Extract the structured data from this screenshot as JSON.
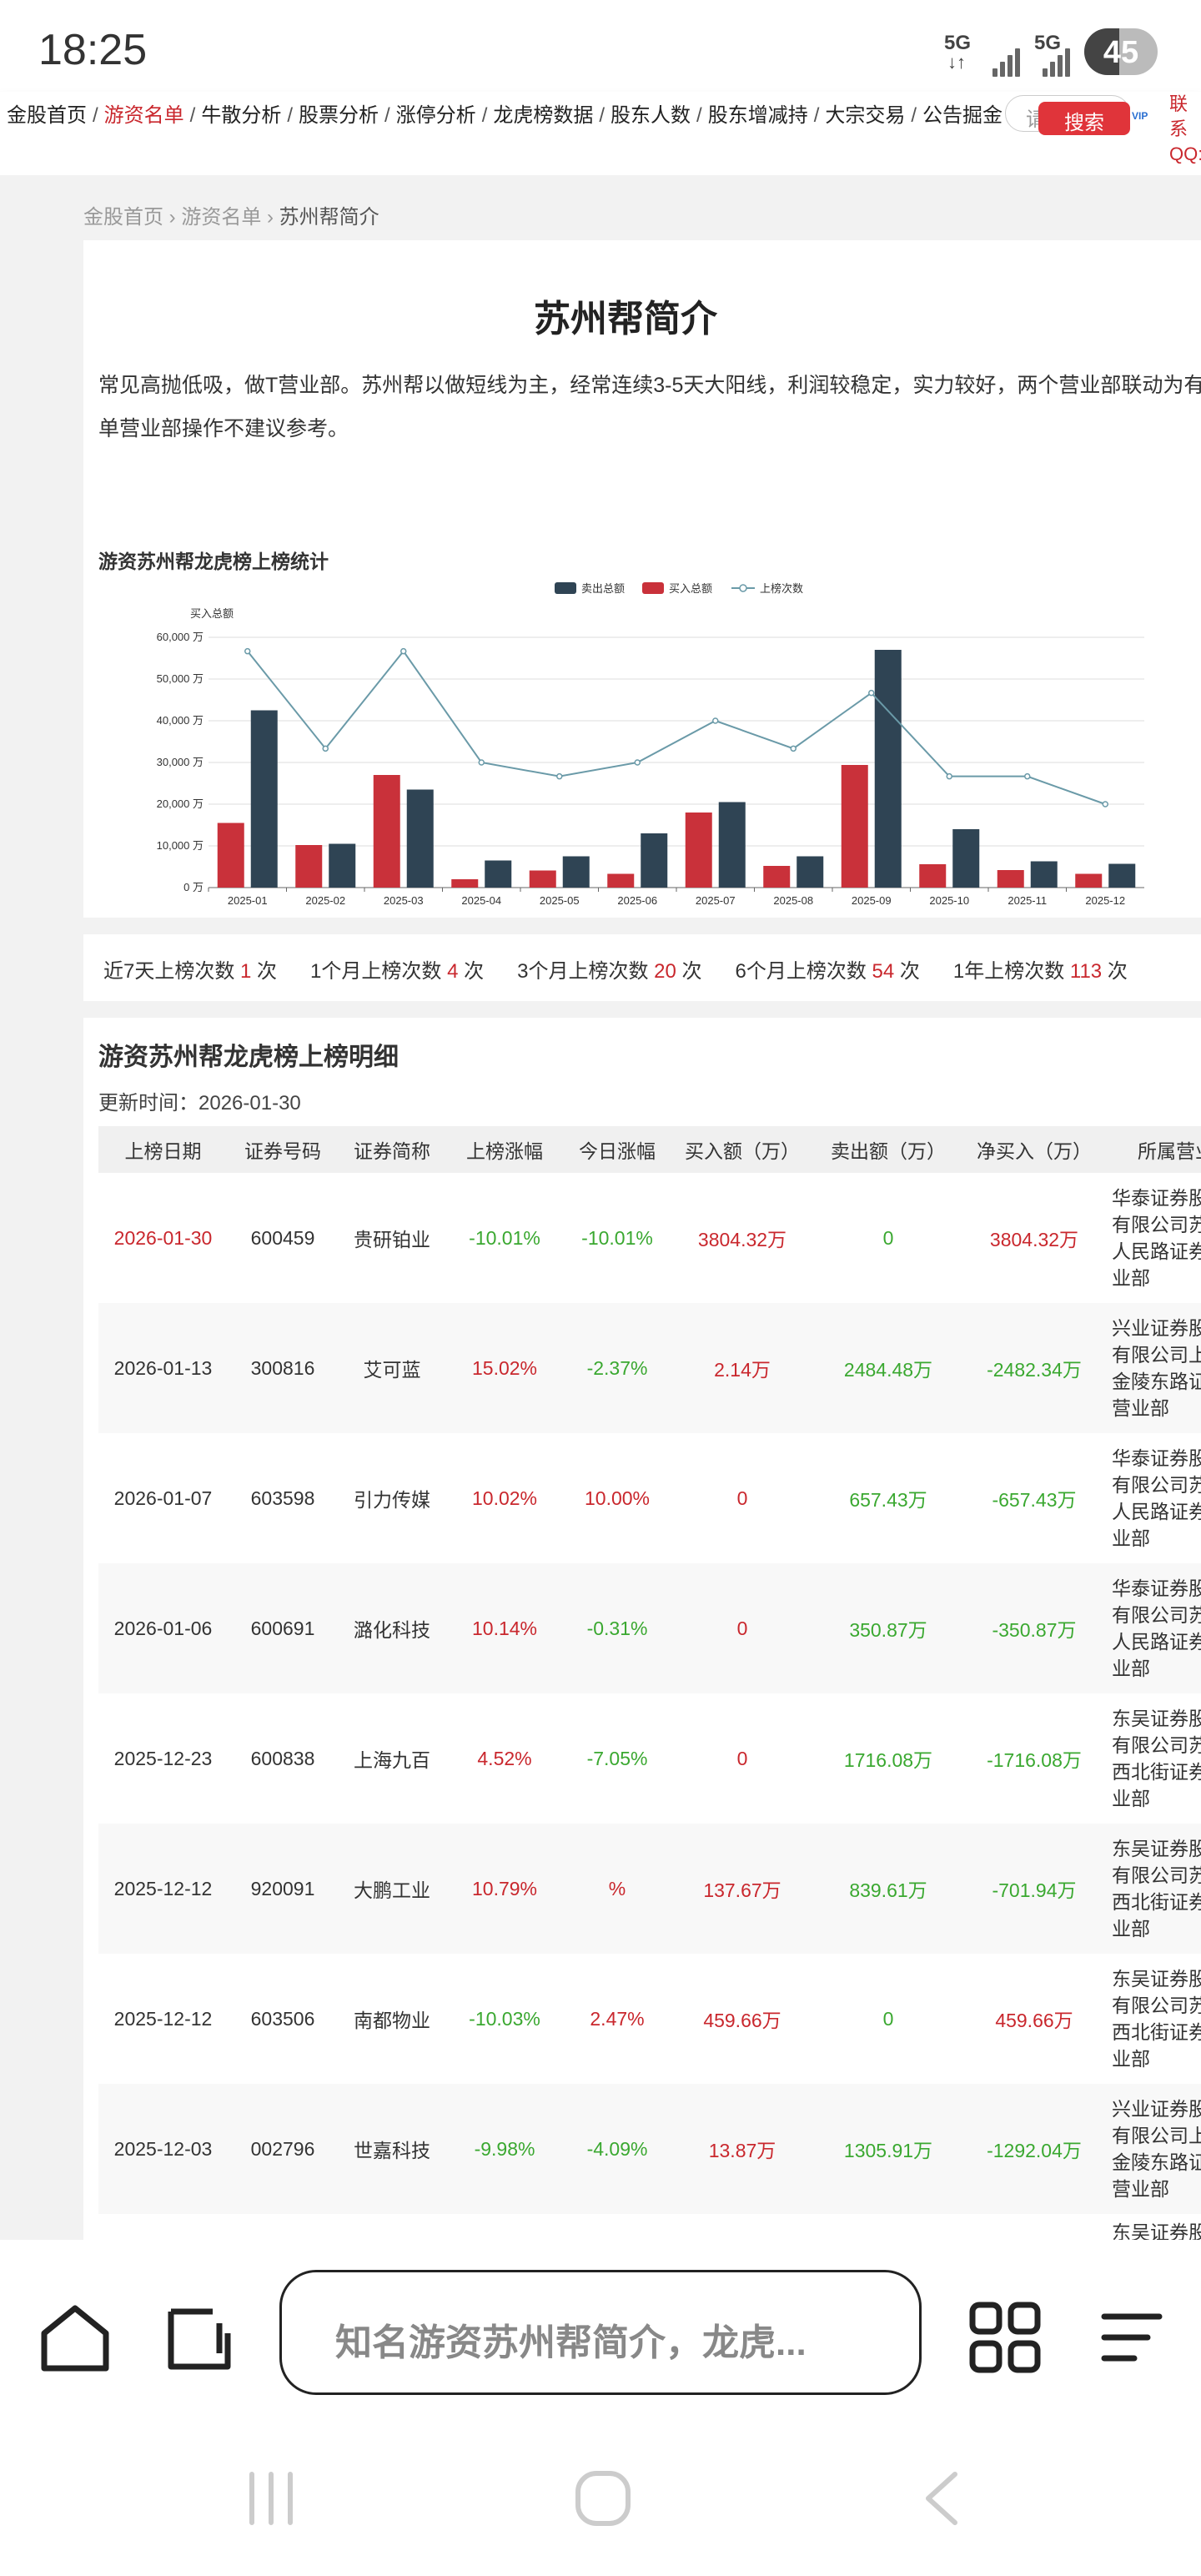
{
  "status": {
    "time": "18:25",
    "net1": "5G",
    "net2": "5G",
    "battery": "45"
  },
  "nav": {
    "items": [
      {
        "label": "金股首页",
        "active": false
      },
      {
        "label": "游资名单",
        "active": true
      },
      {
        "label": "牛散分析",
        "active": false
      },
      {
        "label": "股票分析",
        "active": false
      },
      {
        "label": "涨停分析",
        "active": false
      },
      {
        "label": "龙虎榜数据",
        "active": false
      },
      {
        "label": "股东人数",
        "active": false
      },
      {
        "label": "股东增减持",
        "active": false
      },
      {
        "label": "大宗交易",
        "active": false
      },
      {
        "label": "公告掘金",
        "active": false
      }
    ],
    "search_placeholder": "请",
    "search_button": "搜索",
    "vip": "VIP",
    "contact_line1": "联系",
    "contact_line2": "QQ:"
  },
  "breadcrumb": {
    "home": "金股首页",
    "list": "游资名单",
    "current": "苏州帮简介"
  },
  "intro": {
    "title": "苏州帮简介",
    "line1": "常见高抛低吸，做T营业部。苏州帮以做短线为主，经常连续3-5天大阳线，利润较稳定，实力较好，两个营业部联动为有",
    "line2": "单营业部操作不建议参考。"
  },
  "chart_data": {
    "type": "bar",
    "title": "游资苏州帮龙虎榜上榜统计",
    "ylabel": "买入总额",
    "ylim": [
      0,
      60000
    ],
    "yticks": [
      "0 万",
      "10,000 万",
      "20,000 万",
      "30,000 万",
      "40,000 万",
      "50,000 万",
      "60,000 万"
    ],
    "categories": [
      "2025-01",
      "2025-02",
      "2025-03",
      "2025-04",
      "2025-05",
      "2025-06",
      "2025-07",
      "2025-08",
      "2025-09",
      "2025-10",
      "2025-11",
      "2025-12"
    ],
    "series": [
      {
        "name": "卖出总额",
        "kind": "bar",
        "color": "#2f4454",
        "values": [
          42500,
          10500,
          23500,
          6500,
          7500,
          13000,
          20500,
          7500,
          57000,
          14000,
          6300,
          5700
        ]
      },
      {
        "name": "买入总额",
        "kind": "bar",
        "color": "#c9313a",
        "values": [
          15500,
          10200,
          27000,
          2000,
          4100,
          3300,
          18000,
          5200,
          29400,
          5600,
          4200,
          3300
        ]
      },
      {
        "name": "上榜次数",
        "kind": "line",
        "color": "#6a9aa8",
        "values": [
          17,
          10,
          17,
          9,
          8,
          9,
          12,
          10,
          14,
          8,
          8,
          6
        ]
      }
    ],
    "line_ymax": 18,
    "legend_position": "top-center",
    "grid": true
  },
  "stats": [
    {
      "label": "近7天上榜次数",
      "value": "1",
      "unit": "次"
    },
    {
      "label": "1个月上榜次数",
      "value": "4",
      "unit": "次"
    },
    {
      "label": "3个月上榜次数",
      "value": "20",
      "unit": "次"
    },
    {
      "label": "6个月上榜次数",
      "value": "54",
      "unit": "次"
    },
    {
      "label": "1年上榜次数",
      "value": "113",
      "unit": "次"
    }
  ],
  "detail": {
    "title": "游资苏州帮龙虎榜上榜明细",
    "update_label": "更新时间：",
    "update_value": "2026-01-30",
    "headers": [
      "上榜日期",
      "证券号码",
      "证券简称",
      "上榜涨幅",
      "今日涨幅",
      "买入额（万）",
      "卖出额（万）",
      "净买入（万）",
      "所属营业部"
    ],
    "rows": [
      {
        "date": "2026-01-30",
        "code": "600459",
        "name": "贵研铂业",
        "rise": "-10.01%",
        "today": "-10.01%",
        "buy": "3804.32万",
        "sell": "0",
        "net": "3804.32万",
        "dept": [
          "华泰证券股",
          "有限公司苏",
          "人民路证券",
          "业部"
        ],
        "date_red": true
      },
      {
        "date": "2026-01-13",
        "code": "300816",
        "name": "艾可蓝",
        "rise": "15.02%",
        "today": "-2.37%",
        "buy": "2.14万",
        "sell": "2484.48万",
        "net": "-2482.34万",
        "dept": [
          "兴业证券股",
          "有限公司上",
          "金陵东路证",
          "营业部"
        ]
      },
      {
        "date": "2026-01-07",
        "code": "603598",
        "name": "引力传媒",
        "rise": "10.02%",
        "today": "10.00%",
        "buy": "0",
        "sell": "657.43万",
        "net": "-657.43万",
        "dept": [
          "华泰证券股",
          "有限公司苏",
          "人民路证券",
          "业部"
        ]
      },
      {
        "date": "2026-01-06",
        "code": "600691",
        "name": "潞化科技",
        "rise": "10.14%",
        "today": "-0.31%",
        "buy": "0",
        "sell": "350.87万",
        "net": "-350.87万",
        "dept": [
          "华泰证券股",
          "有限公司苏",
          "人民路证券",
          "业部"
        ]
      },
      {
        "date": "2025-12-23",
        "code": "600838",
        "name": "上海九百",
        "rise": "4.52%",
        "today": "-7.05%",
        "buy": "0",
        "sell": "1716.08万",
        "net": "-1716.08万",
        "dept": [
          "东吴证券股",
          "有限公司苏",
          "西北街证券",
          "业部"
        ]
      },
      {
        "date": "2025-12-12",
        "code": "920091",
        "name": "大鹏工业",
        "rise": "10.79%",
        "today": "%",
        "buy": "137.67万",
        "sell": "839.61万",
        "net": "-701.94万",
        "dept": [
          "东吴证券股",
          "有限公司苏",
          "西北街证券",
          "业部"
        ]
      },
      {
        "date": "2025-12-12",
        "code": "603506",
        "name": "南都物业",
        "rise": "-10.03%",
        "today": "2.47%",
        "buy": "459.66万",
        "sell": "0",
        "net": "459.66万",
        "dept": [
          "东吴证券股",
          "有限公司苏",
          "西北街证券",
          "业部"
        ]
      },
      {
        "date": "2025-12-03",
        "code": "002796",
        "name": "世嘉科技",
        "rise": "-9.98%",
        "today": "-4.09%",
        "buy": "13.87万",
        "sell": "1305.91万",
        "net": "-1292.04万",
        "dept": [
          "兴业证券股",
          "有限公司上",
          "金陵东路证",
          "营业部"
        ]
      }
    ],
    "partial_next_dept": "东吴证券股"
  },
  "bottom": {
    "address_text": "知名游资苏州帮简介，龙虎..."
  },
  "colors": {
    "accent_red": "#c9272d",
    "green": "#3aa830",
    "sell_bar": "#2f4454",
    "buy_bar": "#c9313a",
    "line": "#6a9aa8"
  }
}
